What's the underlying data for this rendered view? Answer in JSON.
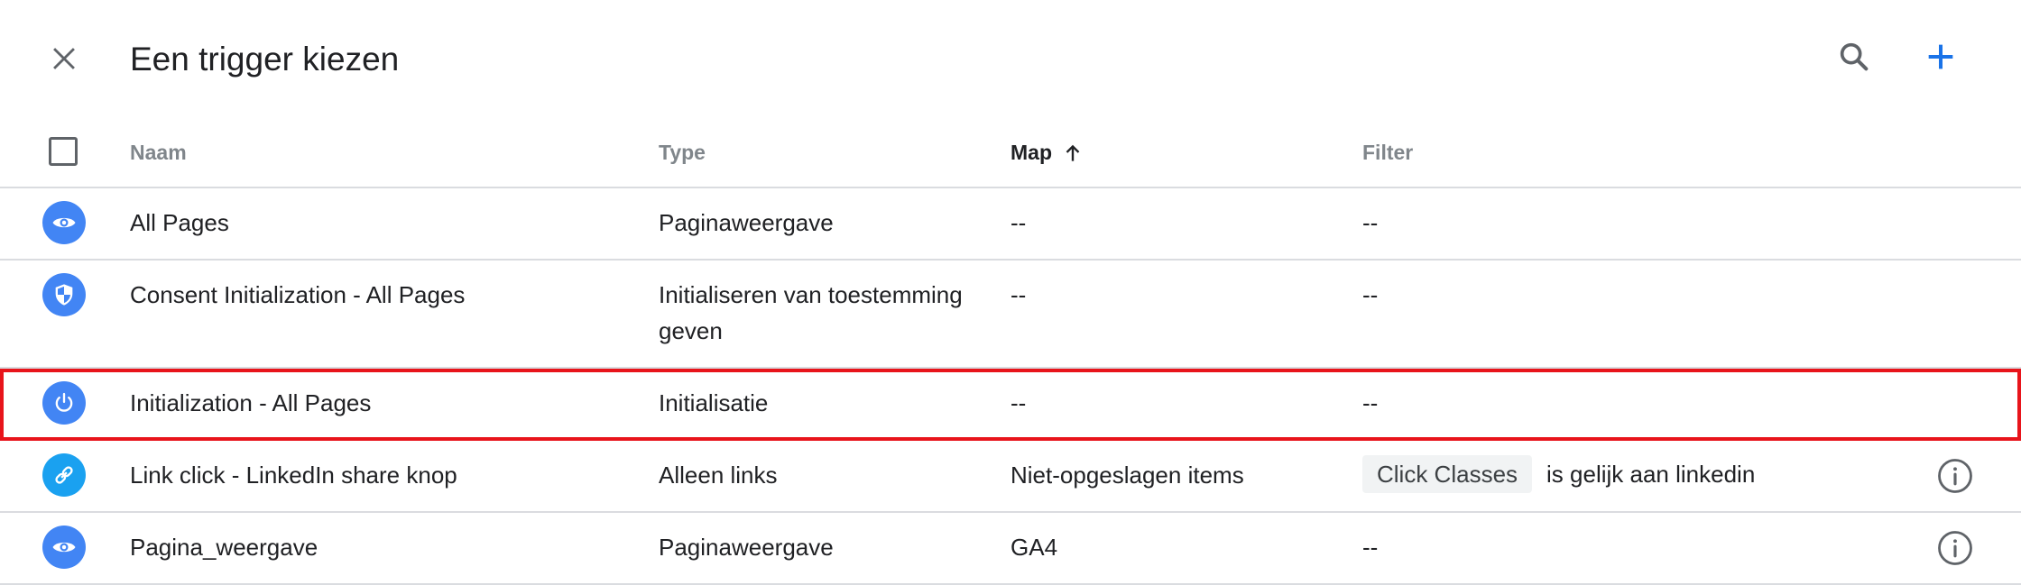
{
  "header": {
    "title": "Een trigger kiezen",
    "icons": {
      "close": "close-icon",
      "search": "search-icon",
      "add": "plus-icon"
    }
  },
  "table": {
    "columns": {
      "name": "Naam",
      "type": "Type",
      "map": "Map",
      "filter": "Filter"
    },
    "sorted_column": "map",
    "sort_direction": "ascending",
    "rows": [
      {
        "icon": "eye-icon",
        "icon_color": "#4285f4",
        "name": "All Pages",
        "type": "Paginaweergave",
        "map": "--",
        "filter": "--",
        "has_info": false
      },
      {
        "icon": "shield-icon",
        "icon_color": "#4285f4",
        "name": "Consent Initialization - All Pages",
        "type": "Initialiseren van toestemming geven",
        "map": "--",
        "filter": "--",
        "has_info": false
      },
      {
        "icon": "power-icon",
        "icon_color": "#4285f4",
        "name": "Initialization - All Pages",
        "type": "Initialisatie",
        "map": "--",
        "filter": "--",
        "has_info": false,
        "highlighted": true
      },
      {
        "icon": "link-icon",
        "icon_color": "#1aa1f0",
        "name": "Link click - LinkedIn share knop",
        "type": "Alleen links",
        "map": "Niet-opgeslagen items",
        "filter_chip": "Click Classes",
        "filter_text": "is gelijk aan linkedin",
        "has_info": true
      },
      {
        "icon": "eye-icon",
        "icon_color": "#4285f4",
        "name": "Pagina_weergave",
        "type": "Paginaweergave",
        "map": "GA4",
        "filter": "--",
        "has_info": true
      }
    ]
  },
  "colors": {
    "accent": "#1a73e8",
    "highlight_border": "#e8141b",
    "divider": "#dadce0"
  }
}
